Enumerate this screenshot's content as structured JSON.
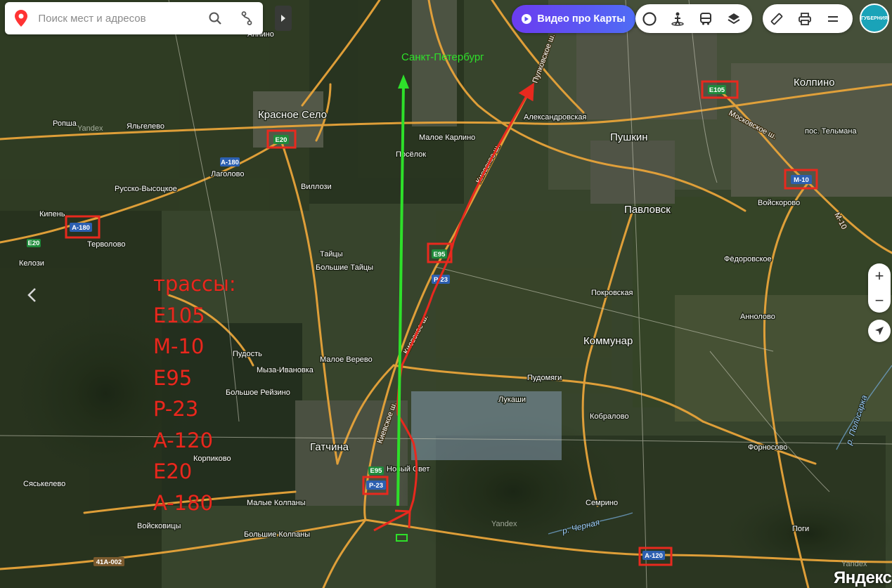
{
  "search": {
    "placeholder": "Поиск мест и адресов"
  },
  "toolbar": {
    "video_label": "Видео про Карты"
  },
  "avatar": {
    "text": "ГУБЕРНИЯ"
  },
  "zoom": {
    "plus": "+",
    "minus": "−"
  },
  "logo": "Яндекс",
  "watermark": "Yandex",
  "icons": {
    "pin": "location-pin-icon",
    "search": "search-icon",
    "route": "route-icon",
    "collapse": "chevron-right-icon",
    "play": "play-icon",
    "layers_group": [
      "traffic-circle-icon",
      "panorama-person-icon",
      "transit-bus-icon",
      "layers-icon"
    ],
    "tools_group": [
      "ruler-icon",
      "print-icon",
      "menu-icon"
    ],
    "locate": "locate-arrow-icon",
    "back": "chevron-left-icon"
  },
  "colors": {
    "annotation_red": "#e8291e",
    "annotation_green": "#2ee02a",
    "road_orange": "#e8a43a",
    "accent_purple": "#6b3cf0"
  },
  "annotations": {
    "destination": "Санкт-Петербург",
    "legend_lines": [
      "трассы:",
      "E105",
      "M-10",
      "E95",
      "P-23",
      "A-120",
      "E20",
      "A-180"
    ]
  },
  "places": {
    "krasnoe_selo": "Красное Село",
    "pushkin": "Пушкин",
    "kolpino": "Колпино",
    "pavlovsk": "Павловск",
    "gatchina": "Гатчина",
    "kommunar": "Коммунар",
    "ropsha": "Ропша",
    "yalgelevo": "Яльгелево",
    "russko_vysotskoe": "Русско-Высоцкое",
    "lagolovo": "Лаголово",
    "villozi": "Виллози",
    "kipen": "Кипень",
    "tervolovo": "Терволово",
    "kelozi": "Келози",
    "taitsy": "Тайцы",
    "bolshie_taitsy": "Большие Тайцы",
    "maloe_karlino": "Малое Карлино",
    "poselok": "Посёлок",
    "aleksandrovskaya": "Александровская",
    "pos_telmana": "пос. Тельмана",
    "voiskorovo": "Войскорово",
    "fedorovskoe": "Фёдоровское",
    "pokrovskaya": "Покровская",
    "annolovo": "Аннолово",
    "pudost": "Пудость",
    "maloe_verevo": "Малое Верево",
    "myza_ivanovka": "Мыза-Ивановка",
    "bolshoe_reizino": "Большое Рейзино",
    "pudomyagi": "Пудомяги",
    "lukashi": "Лукаши",
    "kobralovo": "Кобралово",
    "fornosovo": "Форносово",
    "novy_svet": "Новый Свет",
    "korpikovo": "Корпиково",
    "syaskelevo": "Сяськелево",
    "malye_kolpany": "Малые Колпаны",
    "voiskovitsy": "Войсковицы",
    "bolshie_kolpany": "Большие Колпаны",
    "semrino": "Семрино",
    "pogi": "Поги",
    "antino": "Аннино"
  },
  "roads": {
    "pulkovskoe": "Пулковское ш.",
    "kievskoe_top": "Киевское ш.",
    "kievskoe_mid": "Киевское ш.",
    "kievskoe_low": "Киевское ш.",
    "moskovskoe": "Московское ш.",
    "m10_road": "М-10"
  },
  "rivers": {
    "polisarka": "р. Полисарка",
    "chernaya": "р. Черная"
  },
  "shields": {
    "e105": "E105",
    "e20_top": "E20",
    "a180_top": "A-180",
    "a180_left": "A-180",
    "e20_left": "E20",
    "m10": "M-10",
    "e95_mid": "E95",
    "p23_mid": "P-23",
    "e95_low": "E95",
    "p23_low": "P-23",
    "a120": "A-120",
    "r41a002": "41A-002"
  }
}
